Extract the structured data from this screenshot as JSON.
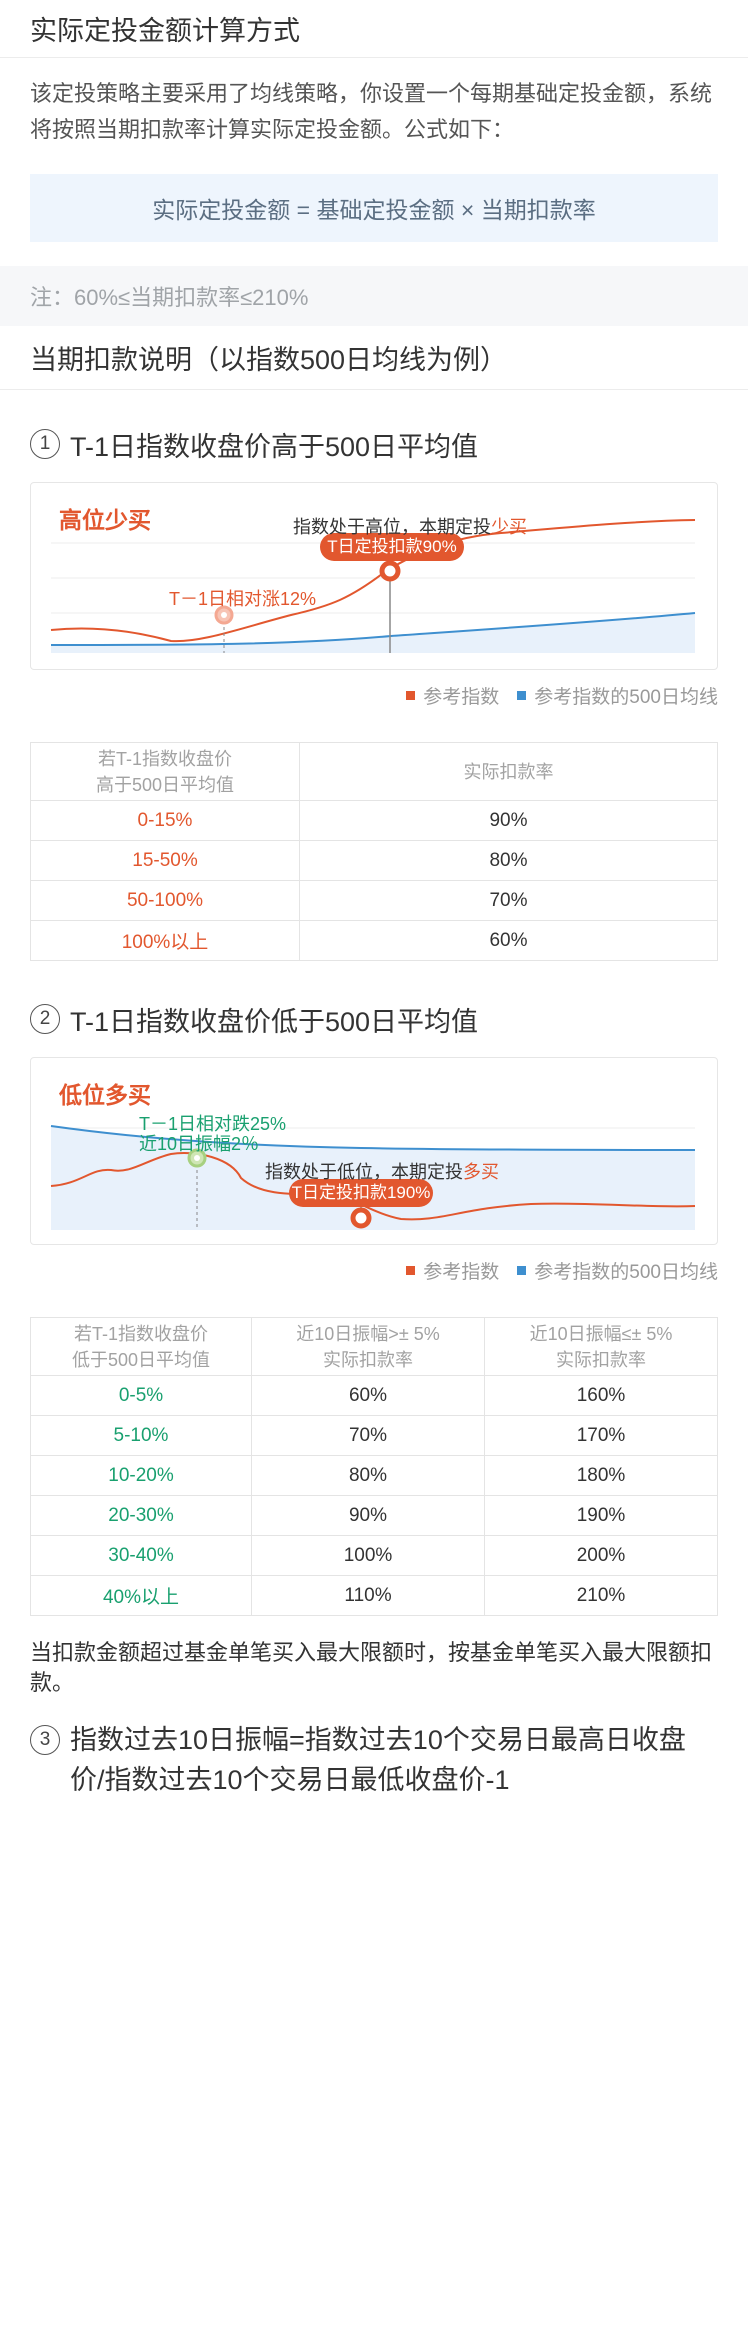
{
  "header1": "实际定投金额计算方式",
  "intro": "该定投策略主要采用了均线策略，你设置一个每期基础定投金额，系统将按照当期扣款率计算实际定投金额。公式如下：",
  "formula": "实际定投金额 = 基础定投金额 × 当期扣款率",
  "note": "注：60%≤当期扣款率≤210%",
  "header2": "当期扣款说明（以指数500日均线为例）",
  "section1": {
    "num": "1",
    "title": "T-1日指数收盘价高于500日平均值",
    "chart_label": "高位少买",
    "annot_text": "指数处于高位，本期定投",
    "annot_highlight": "少买",
    "badge": "T日定投扣款90%",
    "point_label": "T－1日相对涨12%"
  },
  "legend": {
    "index_label": "参考指数",
    "ma_label": "参考指数的500日均线"
  },
  "colors": {
    "red": "#e2572e",
    "blue": "#3e8fcf",
    "green": "#19a06f"
  },
  "table1": {
    "headers": [
      "若T-1指数收盘价\n高于500日平均值",
      "实际扣款率"
    ],
    "rows": [
      [
        "0-15%",
        "90%"
      ],
      [
        "15-50%",
        "80%"
      ],
      [
        "50-100%",
        "70%"
      ],
      [
        "100%以上",
        "60%"
      ]
    ]
  },
  "section2": {
    "num": "2",
    "title": "T-1日指数收盘价低于500日平均值",
    "chart_label": "低位多买",
    "point_label_1": "T－1日相对跌25%",
    "point_label_2": "近10日振幅2％",
    "annot_text": "指数处于低位，本期定投",
    "annot_highlight": "多买",
    "badge": "T日定投扣款190%"
  },
  "table2": {
    "headers": [
      "若T-1指数收盘价\n低于500日平均值",
      "近10日振幅>± 5%\n实际扣款率",
      "近10日振幅≤± 5%\n实际扣款率"
    ],
    "rows": [
      [
        "0-5%",
        "60%",
        "160%"
      ],
      [
        "5-10%",
        "70%",
        "170%"
      ],
      [
        "10-20%",
        "80%",
        "180%"
      ],
      [
        "20-30%",
        "90%",
        "190%"
      ],
      [
        "30-40%",
        "100%",
        "200%"
      ],
      [
        "40%以上",
        "110%",
        "210%"
      ]
    ]
  },
  "footnote": "当扣款金额超过基金单笔买入最大限额时，按基金单笔买入最大限额扣款。",
  "section3": {
    "num": "3",
    "text": "指数过去10日振幅=指数过去10个交易日最高日收盘价/指数过去10个交易日最低收盘价-1"
  }
}
